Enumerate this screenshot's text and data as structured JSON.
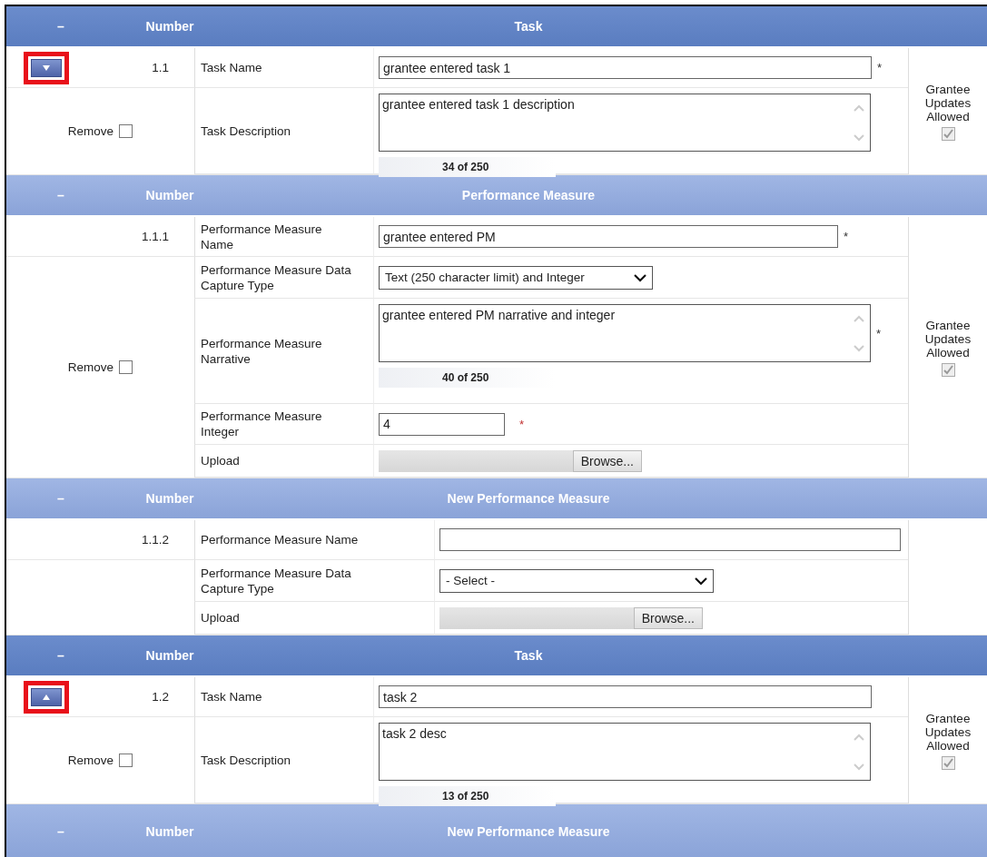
{
  "sections": [
    {
      "kind": "task",
      "header": {
        "collapse": "–",
        "number_label": "Number",
        "title": "Task"
      },
      "number": "1.1",
      "move_button": {
        "kind": "down",
        "highlighted": true
      },
      "remove": {
        "label": "Remove",
        "checked": false
      },
      "fields": [
        {
          "kind": "text",
          "label": "Task Name",
          "value": "grantee entered task 1",
          "required_mark": "*"
        },
        {
          "kind": "textarea",
          "label": "Task Description",
          "value": "grantee entered task 1 description",
          "counter": "34 of 250"
        }
      ],
      "updates": {
        "label": "Grantee Updates Allowed",
        "checked": true,
        "disabled": true
      }
    },
    {
      "kind": "measure",
      "header": {
        "collapse": "–",
        "number_label": "Number",
        "title": "Performance Measure"
      },
      "number": "1.1.1",
      "remove": {
        "label": "Remove",
        "checked": false
      },
      "fields": [
        {
          "kind": "text",
          "label": "Performance Measure Name",
          "value": "grantee entered PM",
          "required_mark": "*"
        },
        {
          "kind": "select",
          "label": "Performance Measure Data Capture Type",
          "value": "Text (250 character limit) and Integer"
        },
        {
          "kind": "textarea",
          "label": "Performance Measure Narrative",
          "value": "grantee entered PM narrative and integer",
          "counter": "40 of 250",
          "required_mark": "*"
        },
        {
          "kind": "integer",
          "label": "Performance Measure Integer",
          "value": "4",
          "required_mark": "*"
        },
        {
          "kind": "upload",
          "label": "Upload",
          "button": "Browse..."
        }
      ],
      "updates": {
        "label": "Grantee Updates Allowed",
        "checked": true,
        "disabled": true
      }
    },
    {
      "kind": "new_measure",
      "header": {
        "collapse": "–",
        "number_label": "Number",
        "title": "New Performance Measure"
      },
      "number": "1.1.2",
      "fields": [
        {
          "kind": "text",
          "label": "Performance Measure Name"
        },
        {
          "kind": "select",
          "label": "Performance Measure Data Capture Type",
          "value": "- Select -"
        },
        {
          "kind": "upload",
          "label": "Upload",
          "button": "Browse..."
        }
      ]
    },
    {
      "kind": "task",
      "header": {
        "collapse": "–",
        "number_label": "Number",
        "title": "Task"
      },
      "number": "1.2",
      "move_button": {
        "kind": "up",
        "highlighted": true
      },
      "remove": {
        "label": "Remove",
        "checked": false
      },
      "fields": [
        {
          "kind": "text",
          "label": "Task Name",
          "value": "task 2"
        },
        {
          "kind": "textarea",
          "label": "Task Description",
          "value": "task 2 desc",
          "counter": "13 of 250"
        }
      ],
      "updates": {
        "label": "Grantee Updates Allowed",
        "checked": true,
        "disabled": true
      }
    },
    {
      "kind": "header_only",
      "header": {
        "collapse": "–",
        "number_label": "Number",
        "title": "New Performance Measure"
      }
    }
  ]
}
